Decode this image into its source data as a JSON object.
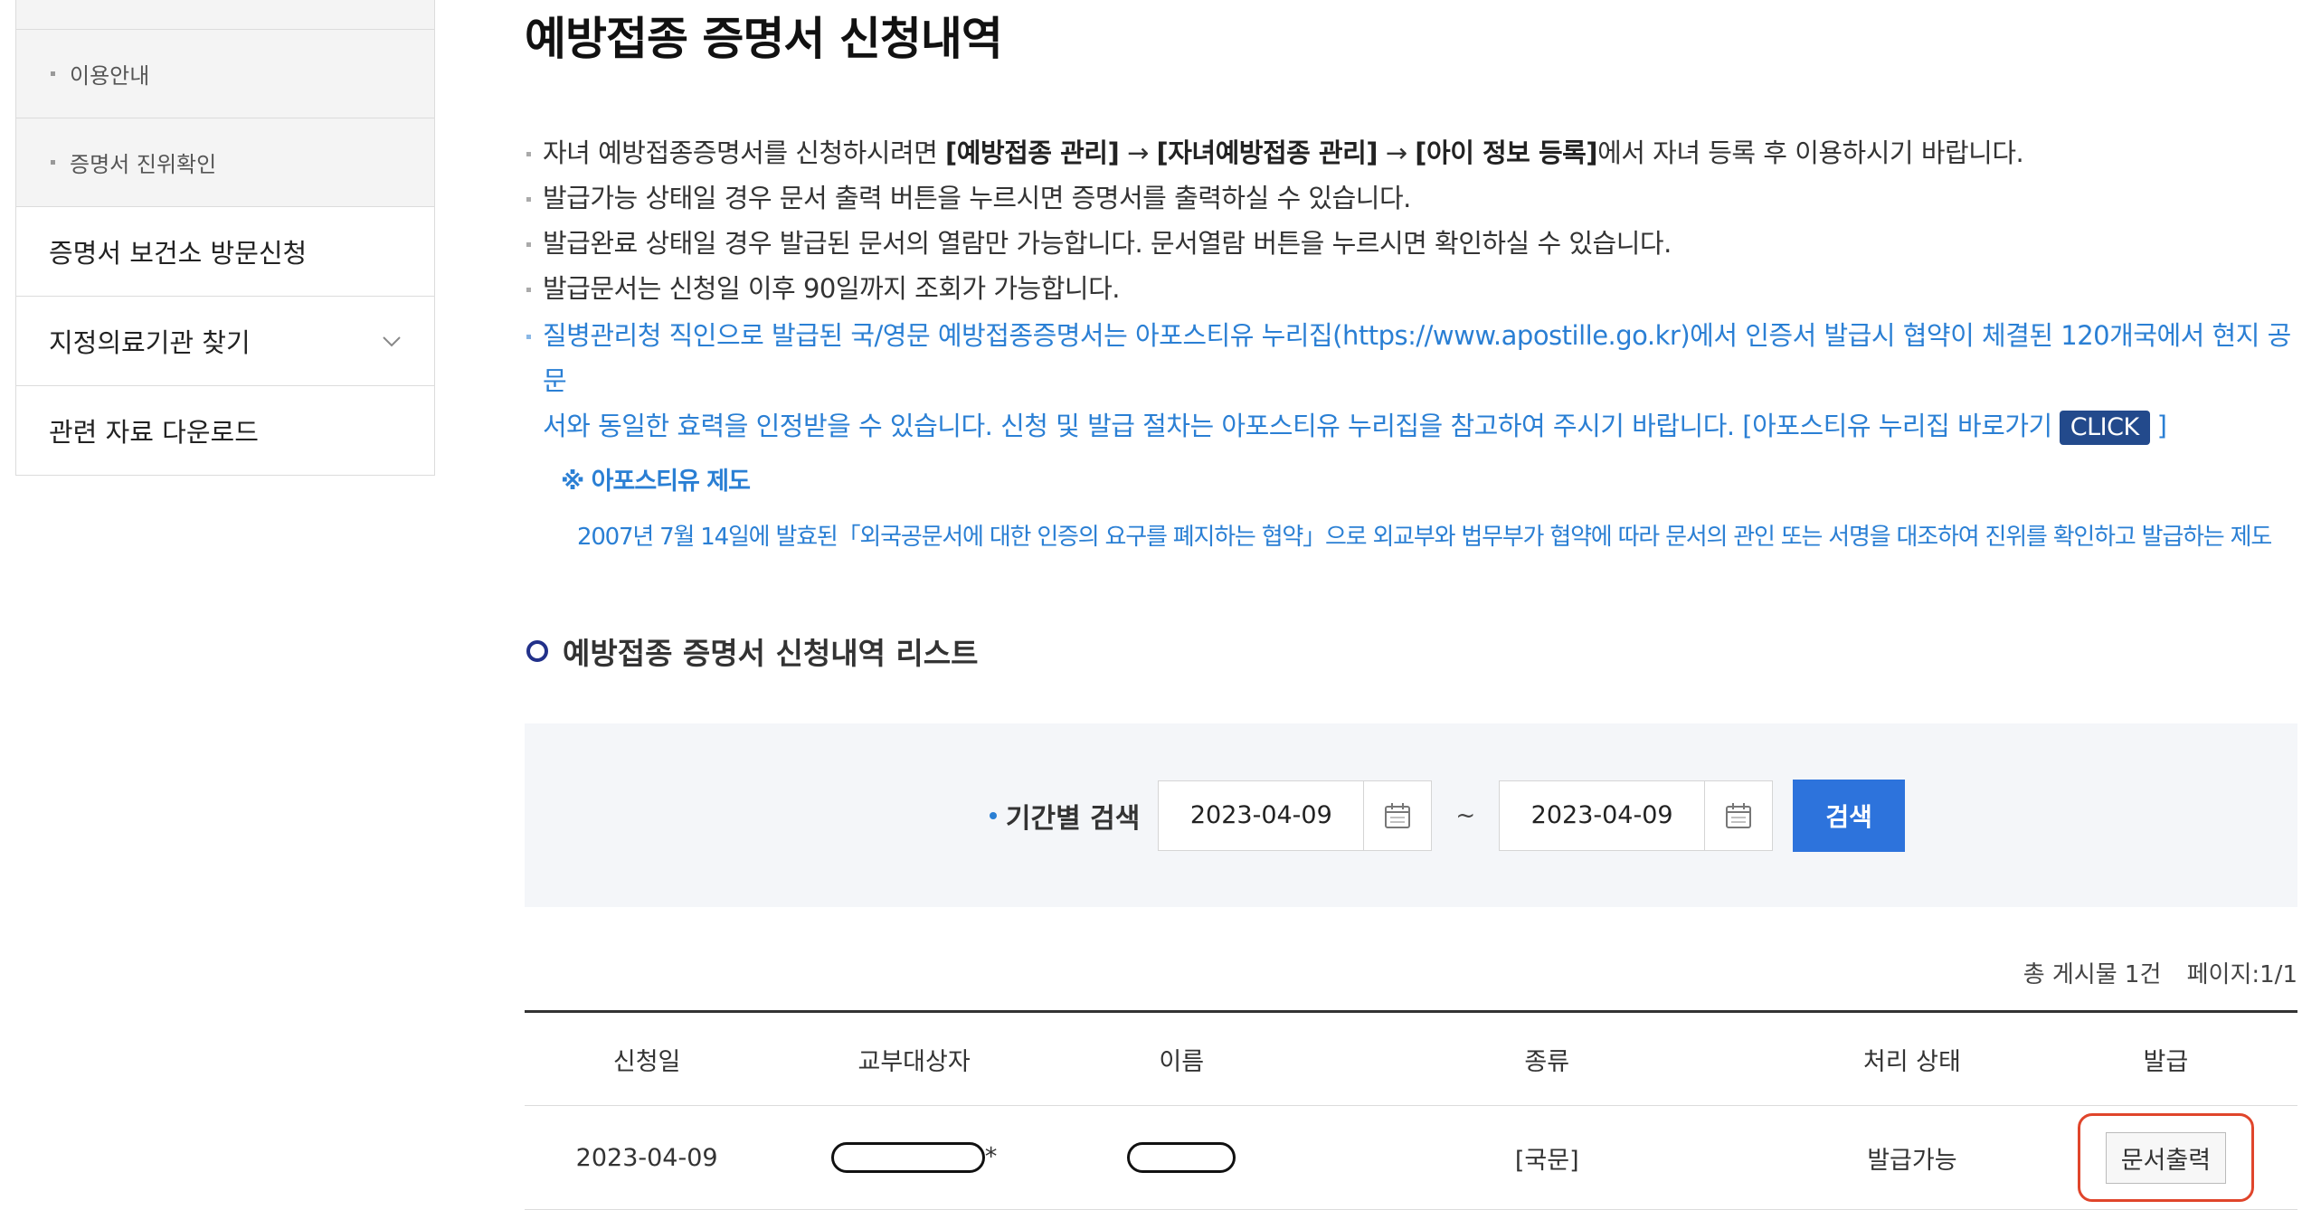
{
  "sidebar": {
    "sub_items": [
      {
        "label": "이용안내"
      },
      {
        "label": "증명서 진위확인"
      }
    ],
    "main_items": [
      {
        "label": "증명서 보건소 방문신청"
      },
      {
        "label": "지정의료기관 찾기"
      },
      {
        "label": "관련 자료 다운로드"
      }
    ]
  },
  "page": {
    "title": "예방접종 증명서 신청내역"
  },
  "notes": {
    "n1_a": "자녀 예방접종증명서를 신청하시려면 ",
    "n1_b1": "[예방접종 관리]",
    "n1_arrow1": " → ",
    "n1_b2": "[자녀예방접종 관리]",
    "n1_arrow2": " → ",
    "n1_b3": "[아이 정보 등록]",
    "n1_c": "에서 자녀 등록 후 이용하시기 바랍니다.",
    "n2": "발급가능 상태일 경우 문서 출력 버튼을 누르시면 증명서를 출력하실 수 있습니다.",
    "n3": "발급완료 상태일 경우 발급된 문서의 열람만 가능합니다. 문서열람 버튼을 누르시면 확인하실 수 있습니다.",
    "n4": "발급문서는 신청일 이후 90일까지 조회가 가능합니다.",
    "n5_line1": "질병관리청 직인으로 발급된 국/영문 예방접종증명서는 아포스티유 누리집(https://www.apostille.go.kr)에서 인증서 발급시 협약이 체결된 120개국에서 현지 공문",
    "n5_line2": "서와 동일한 효력을 인정받을 수 있습니다. 신청 및 발급 절차는 아포스티유 누리집을 참고하여 주시기 바랍니다. [아포스티유 누리집 바로가기",
    "click_label": "CLICK",
    "n5_close": "]",
    "apostille_title": "※ 아포스티유 제도",
    "apostille_text": "2007년 7월 14일에 발효된「외국공문서에 대한 인증의 요구를 폐지하는 협약」으로 외교부와 법무부가 협약에 따라 문서의 관인 또는 서명을 대조하여 진위를 확인하고 발급하는 제도"
  },
  "list": {
    "heading": "예방접종 증명서 신청내역 리스트",
    "search_label": "기간별 검색",
    "date_from": "2023-04-09",
    "tilde": "~",
    "date_to": "2023-04-09",
    "search_button": "검색",
    "total": "총 게시물 1건",
    "page": "페이지:1/1",
    "columns": [
      "신청일",
      "교부대상자",
      "이름",
      "종류",
      "처리 상태",
      "발급"
    ],
    "rows": [
      {
        "date": "2023-04-09",
        "recipient_suffix": "*",
        "kind": "[국문]",
        "status": "발급가능",
        "action": "문서출력"
      }
    ]
  },
  "colors": {
    "accent_blue": "#2d73dc",
    "note_blue": "#2a7fd4",
    "highlight": "#e0452b"
  }
}
